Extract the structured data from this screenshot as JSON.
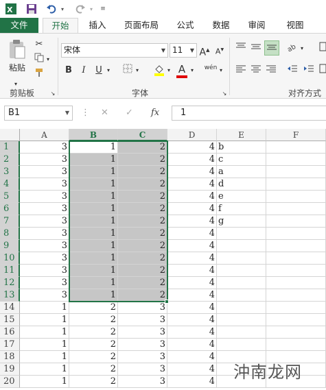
{
  "app": {
    "accent": "#217346"
  },
  "tabs": [
    {
      "label": "文件"
    },
    {
      "label": "开始"
    },
    {
      "label": "插入"
    },
    {
      "label": "页面布局"
    },
    {
      "label": "公式"
    },
    {
      "label": "数据"
    },
    {
      "label": "审阅"
    },
    {
      "label": "视图"
    }
  ],
  "ribbon": {
    "paste_label": "粘贴",
    "clipboard_group": "剪贴板",
    "font_group": "字体",
    "align_group": "对齐方式",
    "font_name": "宋体",
    "font_size": "11",
    "bold": "B",
    "italic": "I",
    "underline": "U",
    "font_color_letter": "A",
    "phonetic": "wén"
  },
  "formula_bar": {
    "name_box": "B1",
    "fx": "fx",
    "value": "1"
  },
  "columns": [
    "A",
    "B",
    "C",
    "D",
    "E",
    "F"
  ],
  "rows": [
    {
      "n": "1",
      "A": "3",
      "B": "1",
      "C": "2",
      "D": "4",
      "E": "b"
    },
    {
      "n": "2",
      "A": "3",
      "B": "1",
      "C": "2",
      "D": "4",
      "E": "c"
    },
    {
      "n": "3",
      "A": "3",
      "B": "1",
      "C": "2",
      "D": "4",
      "E": "a"
    },
    {
      "n": "4",
      "A": "3",
      "B": "1",
      "C": "2",
      "D": "4",
      "E": "d"
    },
    {
      "n": "5",
      "A": "3",
      "B": "1",
      "C": "2",
      "D": "4",
      "E": "e"
    },
    {
      "n": "6",
      "A": "3",
      "B": "1",
      "C": "2",
      "D": "4",
      "E": "f"
    },
    {
      "n": "7",
      "A": "3",
      "B": "1",
      "C": "2",
      "D": "4",
      "E": "g"
    },
    {
      "n": "8",
      "A": "3",
      "B": "1",
      "C": "2",
      "D": "4",
      "E": ""
    },
    {
      "n": "9",
      "A": "3",
      "B": "1",
      "C": "2",
      "D": "4",
      "E": ""
    },
    {
      "n": "10",
      "A": "3",
      "B": "1",
      "C": "2",
      "D": "4",
      "E": ""
    },
    {
      "n": "11",
      "A": "3",
      "B": "1",
      "C": "2",
      "D": "4",
      "E": ""
    },
    {
      "n": "12",
      "A": "3",
      "B": "1",
      "C": "2",
      "D": "4",
      "E": ""
    },
    {
      "n": "13",
      "A": "3",
      "B": "1",
      "C": "2",
      "D": "4",
      "E": ""
    },
    {
      "n": "14",
      "A": "1",
      "B": "2",
      "C": "3",
      "D": "4",
      "E": ""
    },
    {
      "n": "15",
      "A": "1",
      "B": "2",
      "C": "3",
      "D": "4",
      "E": ""
    },
    {
      "n": "16",
      "A": "1",
      "B": "2",
      "C": "3",
      "D": "4",
      "E": ""
    },
    {
      "n": "17",
      "A": "1",
      "B": "2",
      "C": "3",
      "D": "4",
      "E": ""
    },
    {
      "n": "18",
      "A": "1",
      "B": "2",
      "C": "3",
      "D": "4",
      "E": ""
    },
    {
      "n": "19",
      "A": "1",
      "B": "2",
      "C": "3",
      "D": "4",
      "E": ""
    },
    {
      "n": "20",
      "A": "1",
      "B": "2",
      "C": "3",
      "D": "4",
      "E": ""
    }
  ],
  "watermark": "沖南龙网"
}
